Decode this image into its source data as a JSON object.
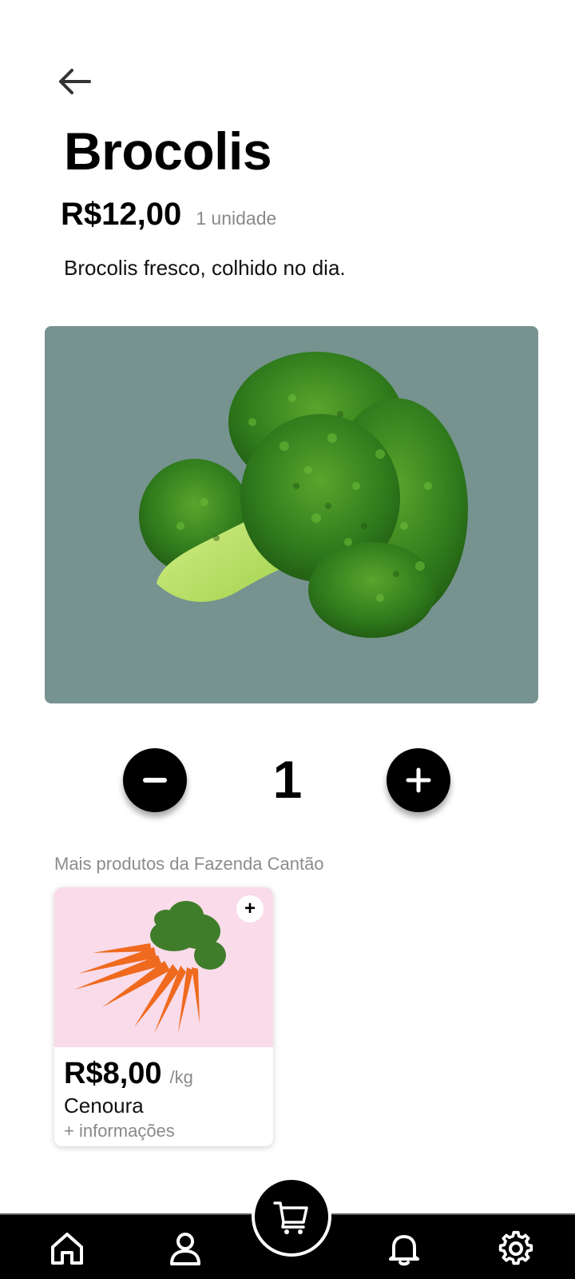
{
  "product": {
    "name": "Brocolis",
    "price": "R$12,00",
    "unit": "1 unidade",
    "description": "Brocolis fresco, colhido no dia.",
    "image_background": "#76938f"
  },
  "stepper": {
    "quantity": "1"
  },
  "more_products": {
    "title": "Mais produtos da Fazenda Cantão",
    "items": [
      {
        "price": "R$8,00",
        "unit": "/kg",
        "name": "Cenoura",
        "info": "+ informações",
        "add_label": "+",
        "image_background": "#f9dbea"
      }
    ]
  },
  "nav": {
    "items": [
      "home-icon",
      "user-icon",
      "cart-icon",
      "bell-icon",
      "gear-icon"
    ],
    "background": "#000000"
  }
}
